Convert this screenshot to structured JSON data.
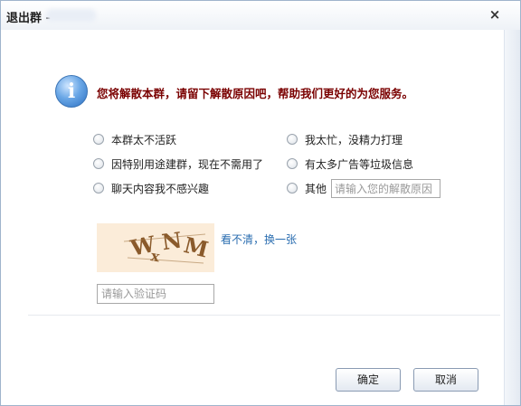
{
  "titlebar": {
    "title": "退出群 -",
    "close_glyph": "×"
  },
  "notice": {
    "icon": "info-icon",
    "icon_glyph": "i",
    "text": "您将解散本群，请留下解散原因吧，帮助我们更好的为您服务。"
  },
  "reasons": [
    {
      "label": "本群太不活跃"
    },
    {
      "label": "我太忙，没精力打理"
    },
    {
      "label": "因特别用途建群，现在不需用了"
    },
    {
      "label": "有太多广告等垃圾信息"
    },
    {
      "label": "聊天内容我不感兴趣"
    },
    {
      "label": "其他"
    }
  ],
  "other_reason": {
    "value": "",
    "placeholder": "请输入您的解散原因"
  },
  "captcha": {
    "image_text": "WxNM",
    "refresh_label": "看不清，换一张"
  },
  "verify": {
    "value": "",
    "placeholder": "请输入验证码"
  },
  "buttons": {
    "ok_label": "确定",
    "cancel_label": "取消"
  },
  "colors": {
    "headline": "#7a0000",
    "link": "#2a6db0",
    "captcha_bg": "#fbecd9",
    "captcha_glyph": "#8a5a2b"
  }
}
